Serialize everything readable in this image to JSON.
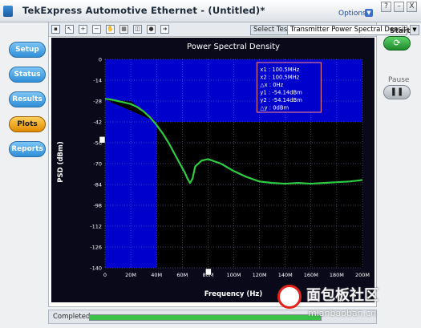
{
  "window": {
    "title": "TekExpress Automotive Ethernet  - (Untitled)*",
    "options_label": "Options",
    "buttons": [
      "?",
      "–",
      "X"
    ]
  },
  "sidebar": {
    "items": [
      {
        "label": "Setup",
        "active": false
      },
      {
        "label": "Status",
        "active": false
      },
      {
        "label": "Results",
        "active": false
      },
      {
        "label": "Plots",
        "active": true
      },
      {
        "label": "Reports",
        "active": false
      }
    ]
  },
  "toolbar": {
    "select_test_label": "Select Test",
    "select_test_value": "Transmitter Power Spectral Densit...",
    "tools": [
      "save-icon",
      "cursor-icon",
      "zoom-in-icon",
      "zoom-out-icon",
      "pan-icon",
      "grid-icon",
      "marker-icon",
      "color-icon",
      "export-icon"
    ]
  },
  "controls": {
    "start_label": "Start",
    "pause_label": "Pause"
  },
  "status": {
    "text": "Completed",
    "progress": 1.0
  },
  "colors": {
    "accent": "#2f8fd8",
    "plot_bg": "#0000cc",
    "mask": "#000000",
    "trace": "#2ecc40",
    "marker_box": "#ff8a8a"
  },
  "chart_data": {
    "type": "line",
    "title": "Power Spectral Density",
    "xlabel": "Frequency (Hz)",
    "ylabel": "PSD (dBm)",
    "xlim": [
      0,
      200
    ],
    "ylim": [
      -140,
      0
    ],
    "x_ticks": [
      "0",
      "20M",
      "40M",
      "60M",
      "80M",
      "100M",
      "120M",
      "140M",
      "160M",
      "180M",
      "200M"
    ],
    "y_ticks": [
      "0",
      "-14",
      "-28",
      "-42",
      "-56",
      "-70",
      "-84",
      "-98",
      "-112",
      "-126",
      "-140"
    ],
    "grid": true,
    "series": [
      {
        "x": [
          0,
          5,
          10,
          15,
          20,
          25,
          30,
          35,
          40,
          45,
          50,
          55,
          60,
          62,
          64,
          66,
          68,
          70,
          75,
          80,
          90,
          100,
          110,
          120,
          130,
          140,
          150,
          160,
          170,
          180,
          190,
          200
        ],
        "y": [
          -26.5,
          -27,
          -28,
          -29,
          -30,
          -32,
          -35,
          -39,
          -44,
          -50,
          -57,
          -65,
          -73,
          -76,
          -80,
          -83,
          -80,
          -72,
          -68,
          -67,
          -70,
          -75,
          -79,
          -82,
          -83,
          -83.5,
          -83,
          -83.5,
          -83,
          -82.5,
          -82,
          -81
        ]
      }
    ],
    "mask_limit": {
      "x": [
        0,
        20,
        30,
        40,
        40,
        200
      ],
      "y": [
        -27,
        -28,
        -35,
        -42,
        -42,
        -42
      ]
    },
    "marker_readout": [
      "x1 : 100.5MHz",
      "x2 : 100.5MHz",
      "△x : 0Hz",
      "y1 : -54.14dBm",
      "y2 : -54.14dBm",
      "△y : 0dBm"
    ]
  },
  "watermark": {
    "title": "面包板社区",
    "url": "mianbaoban.cn"
  }
}
